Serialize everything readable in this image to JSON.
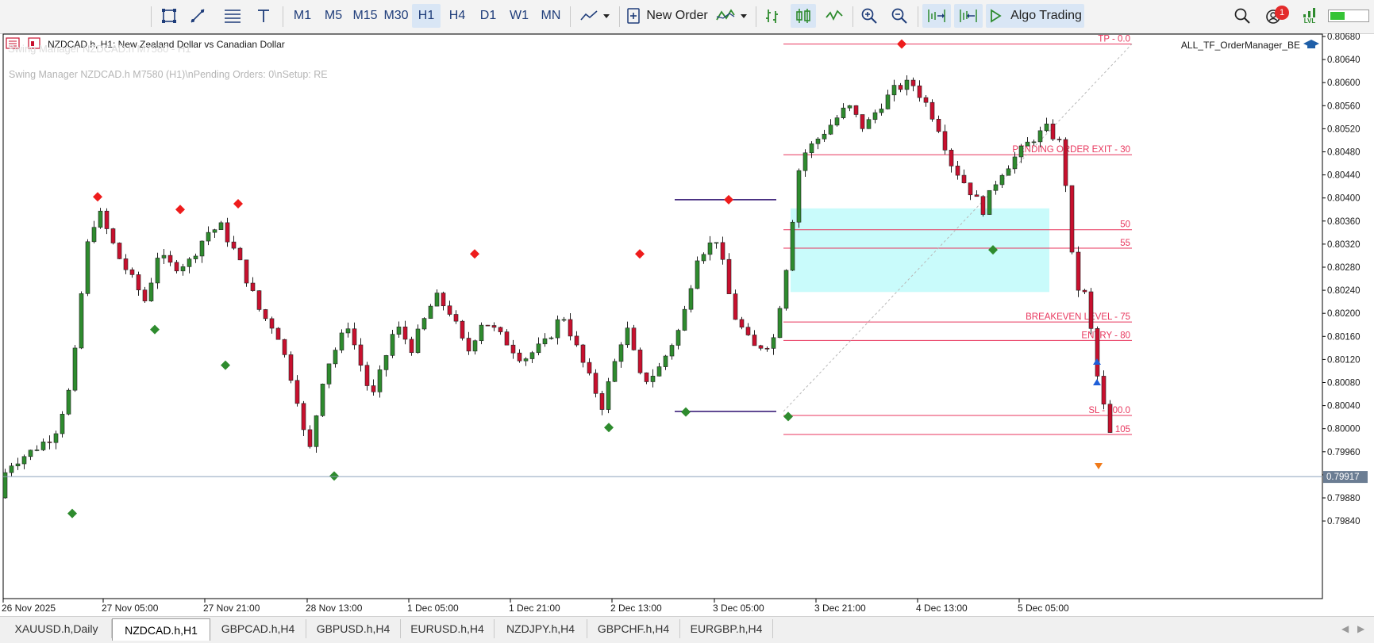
{
  "toolbar": {
    "timeframes": [
      "M1",
      "M5",
      "M15",
      "M30",
      "H1",
      "H4",
      "D1",
      "W1",
      "MN"
    ],
    "active_timeframe": "H1",
    "new_order_label": "New Order",
    "algo_trading_label": "Algo Trading",
    "notification_count": "1",
    "lvl_label": "LVL"
  },
  "chart_header": {
    "symbol_line": "NZDCAD.h, H1:  New Zealand Dollar vs Canadian Dollar",
    "ghost_line": "Swing Manager NZDCAD.h M7580 - H1",
    "comment_line": "Swing Manager NZDCAD.h M7580 (H1)\\nPending Orders: 0\\nSetup: RE",
    "ea_name": "ALL_TF_OrderManager_BE"
  },
  "price_axis": {
    "labels": [
      "0.80680",
      "0.80640",
      "0.80600",
      "0.80560",
      "0.80520",
      "0.80480",
      "0.80440",
      "0.80400",
      "0.80360",
      "0.80320",
      "0.80280",
      "0.80240",
      "0.80200",
      "0.80160",
      "0.80120",
      "0.80080",
      "0.80040",
      "0.80000",
      "0.79960",
      "0.79920",
      "0.79880",
      "0.79840"
    ],
    "current_price": "0.79917"
  },
  "time_axis": {
    "labels": [
      "26 Nov 2025",
      "27 Nov 05:00",
      "27 Nov 21:00",
      "28 Nov 13:00",
      "1 Dec 05:00",
      "1 Dec 21:00",
      "2 Dec 13:00",
      "3 Dec 05:00",
      "3 Dec 21:00",
      "4 Dec 13:00",
      "5 Dec 05:00"
    ]
  },
  "levels": [
    {
      "label": "TP - 0.0",
      "price": 0.80667
    },
    {
      "label": "PENDING ORDER EXIT - 30",
      "price": 0.80475
    },
    {
      "label": "50",
      "price": 0.80345
    },
    {
      "label": "55",
      "price": 0.80313
    },
    {
      "label": "BREAKEVEN LEVEL - 75",
      "price": 0.80185
    },
    {
      "label": "ENTRY - 80",
      "price": 0.80153
    },
    {
      "label": "SL - 100.0",
      "price": 0.80023
    },
    {
      "label": "105",
      "price": 0.7999
    }
  ],
  "zone": {
    "top": 0.80382,
    "bottom": 0.80237
  },
  "swing_lines": [
    {
      "price": 0.80397
    },
    {
      "price": 0.8003
    }
  ],
  "markers": {
    "highs": [
      {
        "price": 0.80402
      },
      {
        "price": 0.8038
      },
      {
        "price": 0.8039
      },
      {
        "price": 0.80303
      },
      {
        "price": 0.80303
      },
      {
        "price": 0.80397
      },
      {
        "price": 0.80667
      }
    ],
    "lows": [
      {
        "price": 0.79853
      },
      {
        "price": 0.80172
      },
      {
        "price": 0.8011
      },
      {
        "price": 0.79918
      },
      {
        "price": 0.80002
      },
      {
        "price": 0.80029
      },
      {
        "price": 0.80021
      },
      {
        "price": 0.8031
      }
    ]
  },
  "tabs": [
    "XAUUSD.h,Daily",
    "NZDCAD.h,H1",
    "GBPCAD.h,H4",
    "GBPUSD.h,H4",
    "EURUSD.h,H4",
    "NZDJPY.h,H4",
    "GBPCHF.h,H4",
    "EURGBP.h,H4"
  ],
  "active_tab": "NZDCAD.h,H1",
  "colors": {
    "bull": "#2e8b2e",
    "bear": "#c8102e",
    "level": "#e8365d",
    "zone": "#c9fbfb",
    "swing_line": "#2b0d6e",
    "current_price_bg": "#6b7d93",
    "toolbar_icon": "#1f3d7a"
  }
}
